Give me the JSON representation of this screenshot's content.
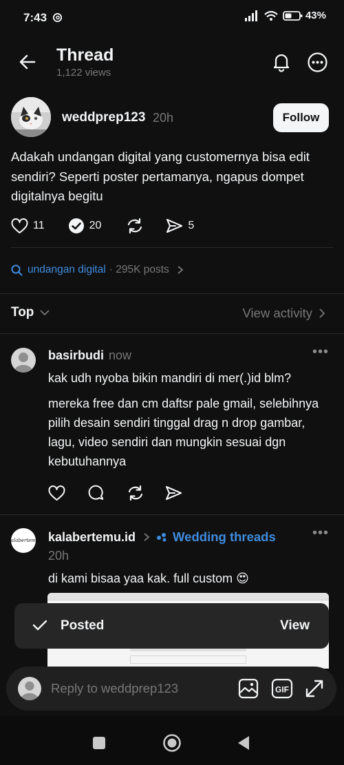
{
  "status_bar": {
    "time": "7:43",
    "battery": "43%"
  },
  "header": {
    "title": "Thread",
    "views": "1,122 views"
  },
  "post": {
    "username": "weddprep123",
    "time": "20h",
    "follow_label": "Follow",
    "text": "Adakah undangan digital yang customernya bisa edit sendiri? Seperti poster pertamanya, ngapus dompet digitalnya begitu",
    "likes": "11",
    "reposts": "20",
    "shares": "5"
  },
  "topic": {
    "tag": "undangan digital",
    "posts": "· 295K posts"
  },
  "filter": {
    "sort_label": "Top",
    "activity_label": "View activity"
  },
  "replies": [
    {
      "username": "basirbudi",
      "time": "now",
      "text1": "kak udh nyoba bikin mandiri di mer(.)id blm?",
      "text2": "mereka free dan cm daftsr pale gmail, selebihnya pilih desain sendiri tinggal drag n drop gambar, lagu, video sendiri dan mungkin sesuai dgn kebutuhannya"
    },
    {
      "username": "kalabertemu.id",
      "community": "Wedding threads",
      "time": "20h",
      "text": "di kami bisaa yaa kak. full custom 😍",
      "avatar_text": "kalabertemu"
    }
  ],
  "toast": {
    "message": "Posted",
    "action": "View"
  },
  "reply_bar": {
    "placeholder": "Reply to weddprep123"
  },
  "colors": {
    "background": "#101010",
    "accent_link": "#3f8cdf",
    "muted": "#777777"
  },
  "icons": [
    "back-arrow-icon",
    "bell-icon",
    "more-icon",
    "heart-icon",
    "repost-icon",
    "share-icon",
    "search-icon",
    "chevron-down-icon",
    "gallery-icon",
    "gif-icon",
    "expand-icon"
  ]
}
